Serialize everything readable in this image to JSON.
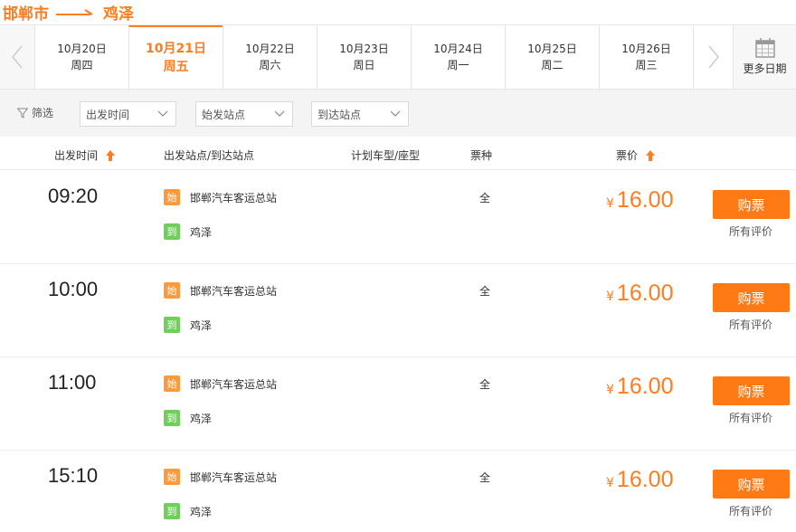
{
  "route": {
    "from": "邯郸市",
    "to": "鸡泽"
  },
  "dates": [
    {
      "date": "10月20日",
      "weekday": "周四",
      "active": false
    },
    {
      "date": "10月21日",
      "weekday": "周五",
      "active": true
    },
    {
      "date": "10月22日",
      "weekday": "周六",
      "active": false
    },
    {
      "date": "10月23日",
      "weekday": "周日",
      "active": false
    },
    {
      "date": "10月24日",
      "weekday": "周一",
      "active": false
    },
    {
      "date": "10月25日",
      "weekday": "周二",
      "active": false
    },
    {
      "date": "10月26日",
      "weekday": "周三",
      "active": false
    }
  ],
  "more_dates_label": "更多日期",
  "filter": {
    "label": "筛选",
    "departure_time": "出发时间",
    "origin_station": "始发站点",
    "arrival_station": "到达站点"
  },
  "table": {
    "headers": {
      "time": "出发时间",
      "stations": "出发站点/到达站点",
      "vehicle": "计划车型/座型",
      "ticket_type": "票种",
      "price": "票价"
    },
    "rows": [
      {
        "time": "09:20",
        "dep_badge": "始",
        "dep": "邯郸汽车客运总站",
        "arr_badge": "到",
        "arr": "鸡泽",
        "ticket": "全",
        "currency": "¥",
        "price": "16.00",
        "buy": "购票",
        "review": "所有评价"
      },
      {
        "time": "10:00",
        "dep_badge": "始",
        "dep": "邯郸汽车客运总站",
        "arr_badge": "到",
        "arr": "鸡泽",
        "ticket": "全",
        "currency": "¥",
        "price": "16.00",
        "buy": "购票",
        "review": "所有评价"
      },
      {
        "time": "11:00",
        "dep_badge": "始",
        "dep": "邯郸汽车客运总站",
        "arr_badge": "到",
        "arr": "鸡泽",
        "ticket": "全",
        "currency": "¥",
        "price": "16.00",
        "buy": "购票",
        "review": "所有评价"
      },
      {
        "time": "15:10",
        "dep_badge": "始",
        "dep": "邯郸汽车客运总站",
        "arr_badge": "到",
        "arr": "鸡泽",
        "ticket": "全",
        "currency": "¥",
        "price": "16.00",
        "buy": "购票",
        "review": "所有评价"
      }
    ]
  },
  "colors": {
    "accent": "#ff7c1f",
    "depart_badge": "#ff9a3c",
    "arrive_badge": "#6fcf5a"
  },
  "icons": {
    "prev": "chevron-left-icon",
    "next": "chevron-right-icon",
    "calendar": "calendar-icon",
    "filter": "funnel-icon",
    "sort": "arrow-up-icon",
    "dropdown": "chevron-down-icon"
  }
}
